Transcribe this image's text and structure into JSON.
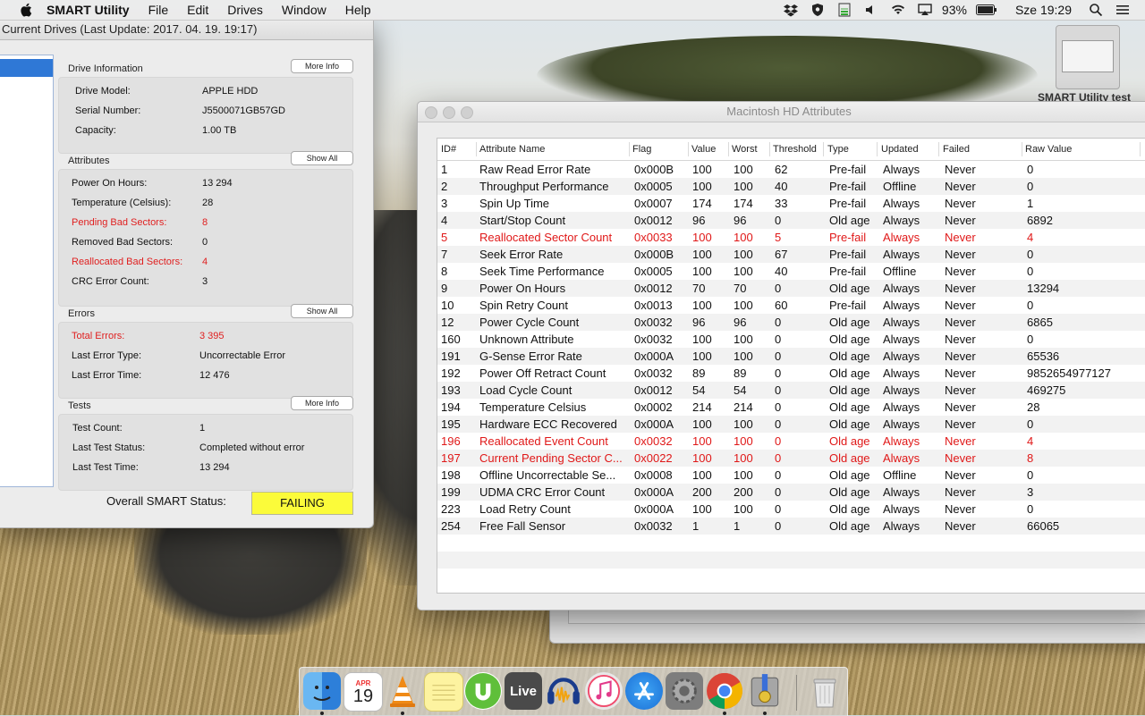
{
  "menubar": {
    "app_name": "SMART Utility",
    "menus": [
      "File",
      "Edit",
      "Drives",
      "Window",
      "Help"
    ],
    "battery_percent": "93%",
    "clock": "Sze 19:29"
  },
  "main_window": {
    "title": "Current Drives (Last Update: 2017. 04. 19. 19:17)",
    "drive_info": {
      "header": "Drive Information",
      "button": "More Info",
      "rows": [
        {
          "key": "Drive Model:",
          "value": "APPLE HDD"
        },
        {
          "key": "Serial Number:",
          "value": "J5500071GB57GD"
        },
        {
          "key": "Capacity:",
          "value": "1.00 TB"
        }
      ]
    },
    "attributes": {
      "header": "Attributes",
      "button": "Show All",
      "rows": [
        {
          "key": "Power On Hours:",
          "value": "13 294",
          "red": false
        },
        {
          "key": "Temperature (Celsius):",
          "value": "28",
          "red": false
        },
        {
          "key": "Pending Bad Sectors:",
          "value": "8",
          "red": true
        },
        {
          "key": "Removed Bad Sectors:",
          "value": "0",
          "red": false
        },
        {
          "key": "Reallocated Bad Sectors:",
          "value": "4",
          "red": true
        },
        {
          "key": "CRC Error Count:",
          "value": "3",
          "red": false
        }
      ]
    },
    "errors": {
      "header": "Errors",
      "button": "Show All",
      "rows": [
        {
          "key": "Total Errors:",
          "value": "3 395",
          "red": true
        },
        {
          "key": "Last Error Type:",
          "value": "Uncorrectable Error",
          "red": false
        },
        {
          "key": "Last Error Time:",
          "value": "12 476",
          "red": false
        }
      ]
    },
    "tests": {
      "header": "Tests",
      "button": "More Info",
      "rows": [
        {
          "key": "Test Count:",
          "value": "1"
        },
        {
          "key": "Last Test Status:",
          "value": "Completed without error"
        },
        {
          "key": "Last Test Time:",
          "value": "13 294"
        }
      ]
    },
    "overall_label": "Overall SMART Status:",
    "overall_status": "FAILING",
    "overall_color": "#fbfb3a"
  },
  "thumbnail_label": "SMART Utility test",
  "attributes_window": {
    "title": "Macintosh HD Attributes",
    "columns": [
      "ID#",
      "Attribute Name",
      "Flag",
      "Value",
      "Worst",
      "Threshold",
      "Type",
      "Updated",
      "Failed",
      "Raw Value"
    ],
    "rows": [
      {
        "id": "1",
        "name": "Raw Read Error Rate",
        "flag": "0x000B",
        "value": "100",
        "worst": "100",
        "threshold": "62",
        "type": "Pre-fail",
        "updated": "Always",
        "failed": "Never",
        "raw": "0",
        "red": false
      },
      {
        "id": "2",
        "name": "Throughput Performance",
        "flag": "0x0005",
        "value": "100",
        "worst": "100",
        "threshold": "40",
        "type": "Pre-fail",
        "updated": "Offline",
        "failed": "Never",
        "raw": "0",
        "red": false
      },
      {
        "id": "3",
        "name": "Spin Up Time",
        "flag": "0x0007",
        "value": "174",
        "worst": "174",
        "threshold": "33",
        "type": "Pre-fail",
        "updated": "Always",
        "failed": "Never",
        "raw": "1",
        "red": false
      },
      {
        "id": "4",
        "name": "Start/Stop Count",
        "flag": "0x0012",
        "value": "96",
        "worst": "96",
        "threshold": "0",
        "type": "Old age",
        "updated": "Always",
        "failed": "Never",
        "raw": "6892",
        "red": false
      },
      {
        "id": "5",
        "name": "Reallocated Sector Count",
        "flag": "0x0033",
        "value": "100",
        "worst": "100",
        "threshold": "5",
        "type": "Pre-fail",
        "updated": "Always",
        "failed": "Never",
        "raw": "4",
        "red": true
      },
      {
        "id": "7",
        "name": "Seek Error Rate",
        "flag": "0x000B",
        "value": "100",
        "worst": "100",
        "threshold": "67",
        "type": "Pre-fail",
        "updated": "Always",
        "failed": "Never",
        "raw": "0",
        "red": false
      },
      {
        "id": "8",
        "name": "Seek Time Performance",
        "flag": "0x0005",
        "value": "100",
        "worst": "100",
        "threshold": "40",
        "type": "Pre-fail",
        "updated": "Offline",
        "failed": "Never",
        "raw": "0",
        "red": false
      },
      {
        "id": "9",
        "name": "Power On Hours",
        "flag": "0x0012",
        "value": "70",
        "worst": "70",
        "threshold": "0",
        "type": "Old age",
        "updated": "Always",
        "failed": "Never",
        "raw": "13294",
        "red": false
      },
      {
        "id": "10",
        "name": "Spin Retry Count",
        "flag": "0x0013",
        "value": "100",
        "worst": "100",
        "threshold": "60",
        "type": "Pre-fail",
        "updated": "Always",
        "failed": "Never",
        "raw": "0",
        "red": false
      },
      {
        "id": "12",
        "name": "Power Cycle Count",
        "flag": "0x0032",
        "value": "96",
        "worst": "96",
        "threshold": "0",
        "type": "Old age",
        "updated": "Always",
        "failed": "Never",
        "raw": "6865",
        "red": false
      },
      {
        "id": "160",
        "name": "Unknown Attribute",
        "flag": "0x0032",
        "value": "100",
        "worst": "100",
        "threshold": "0",
        "type": "Old age",
        "updated": "Always",
        "failed": "Never",
        "raw": "0",
        "red": false
      },
      {
        "id": "191",
        "name": "G-Sense Error Rate",
        "flag": "0x000A",
        "value": "100",
        "worst": "100",
        "threshold": "0",
        "type": "Old age",
        "updated": "Always",
        "failed": "Never",
        "raw": "65536",
        "red": false
      },
      {
        "id": "192",
        "name": "Power Off Retract Count",
        "flag": "0x0032",
        "value": "89",
        "worst": "89",
        "threshold": "0",
        "type": "Old age",
        "updated": "Always",
        "failed": "Never",
        "raw": "9852654977127",
        "red": false
      },
      {
        "id": "193",
        "name": "Load Cycle Count",
        "flag": "0x0012",
        "value": "54",
        "worst": "54",
        "threshold": "0",
        "type": "Old age",
        "updated": "Always",
        "failed": "Never",
        "raw": "469275",
        "red": false
      },
      {
        "id": "194",
        "name": "Temperature Celsius",
        "flag": "0x0002",
        "value": "214",
        "worst": "214",
        "threshold": "0",
        "type": "Old age",
        "updated": "Always",
        "failed": "Never",
        "raw": "28",
        "red": false
      },
      {
        "id": "195",
        "name": "Hardware ECC Recovered",
        "flag": "0x000A",
        "value": "100",
        "worst": "100",
        "threshold": "0",
        "type": "Old age",
        "updated": "Always",
        "failed": "Never",
        "raw": "0",
        "red": false
      },
      {
        "id": "196",
        "name": "Reallocated Event Count",
        "flag": "0x0032",
        "value": "100",
        "worst": "100",
        "threshold": "0",
        "type": "Old age",
        "updated": "Always",
        "failed": "Never",
        "raw": "4",
        "red": true
      },
      {
        "id": "197",
        "name": "Current Pending Sector C...",
        "flag": "0x0022",
        "value": "100",
        "worst": "100",
        "threshold": "0",
        "type": "Old age",
        "updated": "Always",
        "failed": "Never",
        "raw": "8",
        "red": true
      },
      {
        "id": "198",
        "name": "Offline Uncorrectable Se...",
        "flag": "0x0008",
        "value": "100",
        "worst": "100",
        "threshold": "0",
        "type": "Old age",
        "updated": "Offline",
        "failed": "Never",
        "raw": "0",
        "red": false
      },
      {
        "id": "199",
        "name": "UDMA CRC Error Count",
        "flag": "0x000A",
        "value": "200",
        "worst": "200",
        "threshold": "0",
        "type": "Old age",
        "updated": "Always",
        "failed": "Never",
        "raw": "3",
        "red": false
      },
      {
        "id": "223",
        "name": "Load Retry Count",
        "flag": "0x000A",
        "value": "100",
        "worst": "100",
        "threshold": "0",
        "type": "Old age",
        "updated": "Always",
        "failed": "Never",
        "raw": "0",
        "red": false
      },
      {
        "id": "254",
        "name": "Free Fall Sensor",
        "flag": "0x0032",
        "value": "1",
        "worst": "1",
        "threshold": "0",
        "type": "Old age",
        "updated": "Always",
        "failed": "Never",
        "raw": "66065",
        "red": false
      }
    ],
    "red_color": "#e01818"
  },
  "dock": {
    "calendar_month": "APR",
    "calendar_day": "19",
    "live_label": "Live",
    "icons": [
      "finder-icon",
      "calendar-icon",
      "vlc-icon",
      "notes-icon",
      "utorrent-icon",
      "live-icon",
      "audacity-icon",
      "itunes-icon",
      "app-store-icon",
      "system-preferences-icon",
      "chrome-icon",
      "smart-utility-icon",
      "trash-icon"
    ]
  }
}
